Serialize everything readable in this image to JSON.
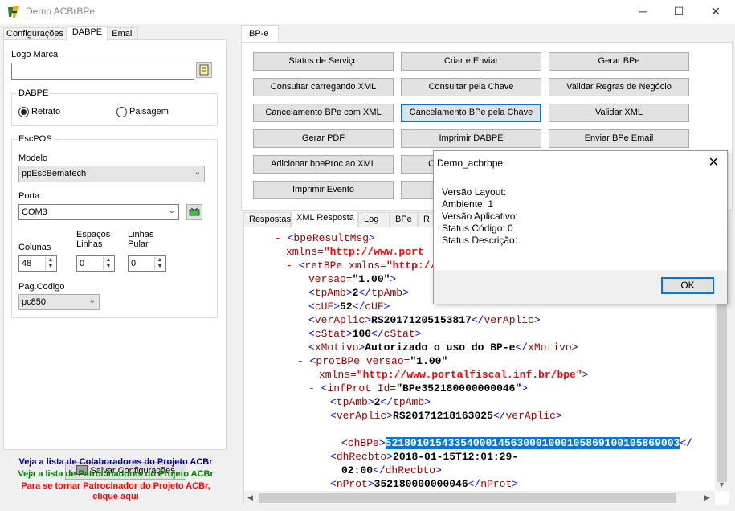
{
  "window": {
    "title": "Demo ACBrBPe",
    "minimize": "─",
    "maximize": "☐",
    "close": "✕"
  },
  "left": {
    "tabs": [
      "Configurações",
      "DABPE",
      "Email"
    ],
    "logo_label": "Logo Marca",
    "logo_value": "",
    "dabpe_group": "DABPE",
    "radio_retrato": "Retrato",
    "radio_paisagem": "Paisagem",
    "escpos_group": "EscPOS",
    "modelo_label": "Modelo",
    "modelo_value": "ppEscBematech",
    "porta_label": "Porta",
    "porta_value": "COM3",
    "colunas_label": "Colunas",
    "colunas_value": "48",
    "espacos_label": "Espaços\nLinhas",
    "espacos_value": "0",
    "linhas_label": "Linhas\nPular",
    "linhas_value": "0",
    "pagcodigo_label": "Pag.Codigo",
    "pagcodigo_value": "pc850",
    "save_button": "Salvar Configurações",
    "credits": [
      {
        "text": "Veja a lista de Colaboradores do Projeto ACBr",
        "color": "#000080"
      },
      {
        "text": "Veja a lista de Patrocinadores do Projeto ACBr",
        "color": "#008000"
      },
      {
        "text": "Para se tornar Patrocinador do Projeto ACBr,",
        "color": "#ff0000"
      },
      {
        "text": "clique aqui",
        "color": "#ff0000"
      }
    ]
  },
  "bpe": {
    "tab": "BP-e",
    "buttons": [
      "Status de Serviço",
      "Criar e Enviar",
      "Gerar BPe",
      "Consultar carregando XML",
      "Consultar pela Chave",
      "Validar Regras de Negócio",
      "Cancelamento BPe com XML",
      "Cancelamento BPe pela Chave",
      "Validar XML",
      "Gerar PDF",
      "Imprimir DABPE",
      "Enviar BPe Email",
      "Adicionar bpeProc ao XML",
      "C",
      "",
      "Imprimir Evento",
      "",
      ""
    ]
  },
  "result_tabs": [
    "Respostas",
    "XML Resposta",
    "Log",
    "BPe",
    "R"
  ],
  "xml": {
    "l1_tag": "bpeResultMsg",
    "l2_attr": "xmlns=",
    "l2_val": "\"http://www.port",
    "l3_tag": "retBPe",
    "l3_attr": " xmlns=",
    "l3_val": "\"http://w",
    "l4_attr": "versao=",
    "l4_val": "\"1.00\"",
    "tpAmb_tag": "tpAmb",
    "tpAmb": "2",
    "cUF_tag": "cUF",
    "cUF": "52",
    "verAplic_tag": "verAplic",
    "verAplic": "RS20171205153817",
    "cStat_tag": "cStat",
    "cStat": "100",
    "xMotivo_tag": "xMotivo",
    "xMotivo": "Autorizado o uso do BP-e",
    "protBPe_tag": "protBPe",
    "protBPe_attr": " versao=",
    "protBPe_val": "\"1.00\"",
    "protBPe_ns_attr": "xmlns=",
    "protBPe_ns_val": "\"http://www.portalfiscal.inf.br/bpe\"",
    "infProt_tag": "infProt",
    "infProt_attr": " Id=",
    "infProt_val": "\"BPe352180000000046\"",
    "tpAmb2": "2",
    "verAplic2": "RS20171218163025",
    "chBPe_tag": "chBPe",
    "chBPe": "52180101543354000145630001000105869100105869003",
    "dhRecbto_tag": "dhRecbto",
    "dhRecbto_a": "2018-01-15T12:01:29-",
    "dhRecbto_b": "02:00",
    "nProt_tag": "nProt",
    "nProt": "352180000000046"
  },
  "dialog": {
    "title": "Demo_acbrbpe",
    "close": "✕",
    "lines": [
      "Versão Layout:",
      "Ambiente: 1",
      "Versão Aplicativo:",
      "Status Código: 0",
      "Status Descrição:"
    ],
    "ok": "OK"
  }
}
